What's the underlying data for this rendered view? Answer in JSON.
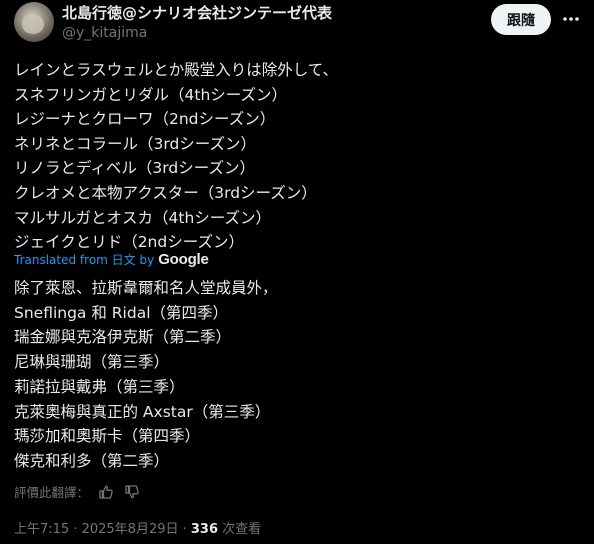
{
  "author": {
    "name": "北島行徳@シナリオ会社ジンテーゼ代表",
    "handle": "@y_kitajima",
    "follow_label": "跟隨"
  },
  "post": {
    "original_lines": [
      "レインとラスウェルとか殿堂入りは除外して、",
      "スネフリンガとリダル（4thシーズン）",
      "レジーナとクローワ（2ndシーズン）",
      "ネリネとコラール（3rdシーズン）",
      "リノラとディベル（3rdシーズン）",
      "クレオメと本物アクスター（3rdシーズン）",
      "マルサルガとオスカ（4thシーズン）",
      "ジェイクとリド（2ndシーズン）"
    ],
    "translation_note": "Translated from 日文 by",
    "translation_provider": "Google",
    "translated_lines": [
      "除了萊恩、拉斯韋爾和名人堂成員外，",
      "Sneflinga 和 Ridal（第四季）",
      "瑞金娜與克洛伊克斯（第二季）",
      "尼琳與珊瑚（第三季）",
      "莉諾拉與戴弗（第三季）",
      "克萊奧梅與真正的 Axstar（第三季）",
      "瑪莎加和奧斯卡（第四季）",
      "傑克和利多（第二季）"
    ]
  },
  "rate_translation": {
    "label": "評價此翻譯：",
    "icons": [
      "thumbs-up-icon",
      "thumbs-down-icon"
    ]
  },
  "meta": {
    "timestamp": "上午7:15 · 2025年8月29日 · ",
    "views_count": "336",
    "views_label": " 次查看"
  },
  "colors": {
    "background": "#000000",
    "text": "#e7e9ea",
    "secondary": "#71767b",
    "link": "#1d9bf0",
    "button_bg": "#eff3f4"
  }
}
